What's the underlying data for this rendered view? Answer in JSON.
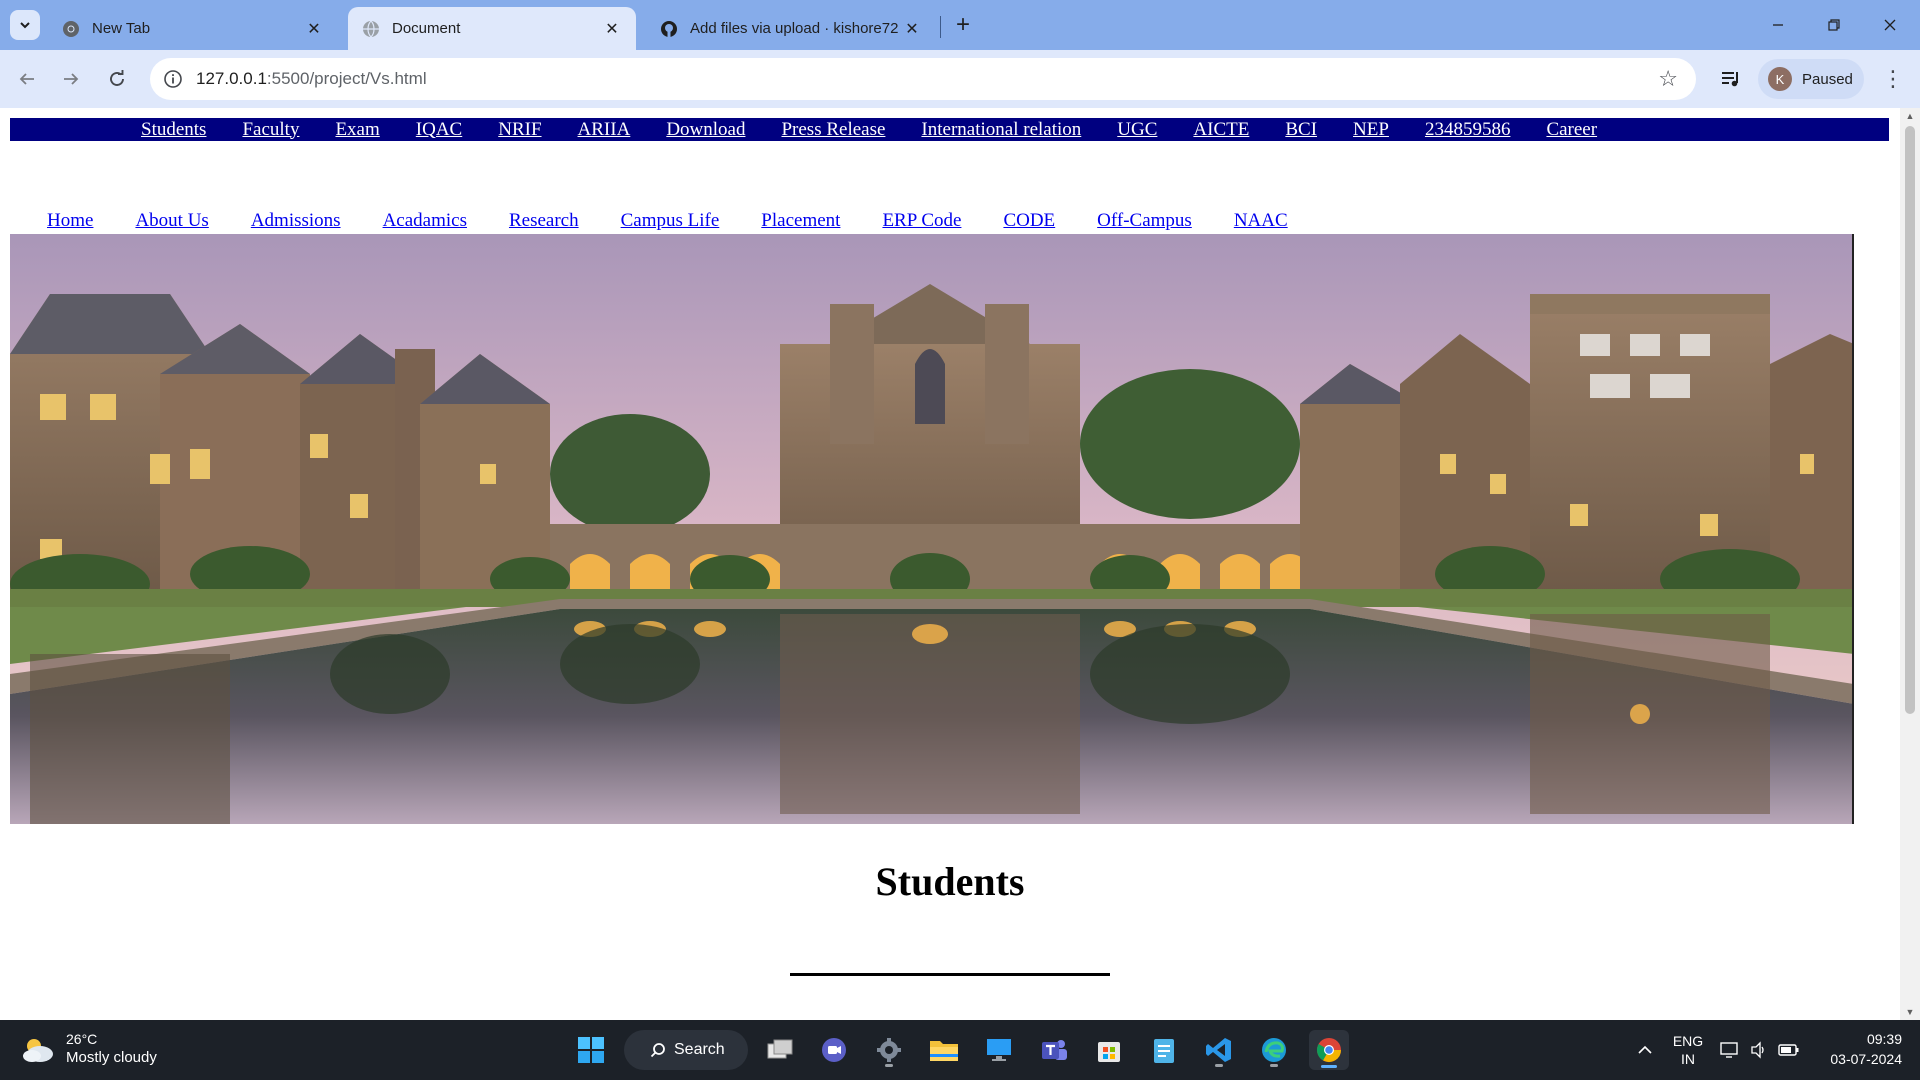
{
  "browser": {
    "tabs": [
      {
        "title": "New Tab",
        "icon": "chrome-icon"
      },
      {
        "title": "Document",
        "icon": "globe-icon",
        "active": true
      },
      {
        "title": "Add files via upload · kishore72",
        "icon": "github-icon"
      }
    ],
    "url_host": "127.0.0.1",
    "url_rest": ":5500/project/Vs.html",
    "profile_initial": "K",
    "profile_status": "Paused"
  },
  "page": {
    "top_nav": [
      "Students",
      "Faculty",
      "Exam",
      "IQAC",
      "NRIF",
      "ARIIA",
      "Download",
      "Press Release",
      "International relation",
      "UGC",
      "AICTE",
      "BCI",
      "NEP",
      "234859586",
      "Career"
    ],
    "main_nav": [
      "Home",
      "About Us",
      "Admissions",
      "Acadamics",
      "Research",
      "Campus Life",
      "Placement",
      "ERP Code",
      "CODE",
      "Off-Campus",
      "NAAC"
    ],
    "section_title": "Students",
    "colors": {
      "top_nav_bg": "#000080",
      "link": "#0000ee"
    }
  },
  "taskbar": {
    "weather_temp": "26°C",
    "weather_cond": "Mostly cloudy",
    "search_label": "Search",
    "lang_top": "ENG",
    "lang_bottom": "IN",
    "time": "09:39",
    "date": "03-07-2024"
  }
}
